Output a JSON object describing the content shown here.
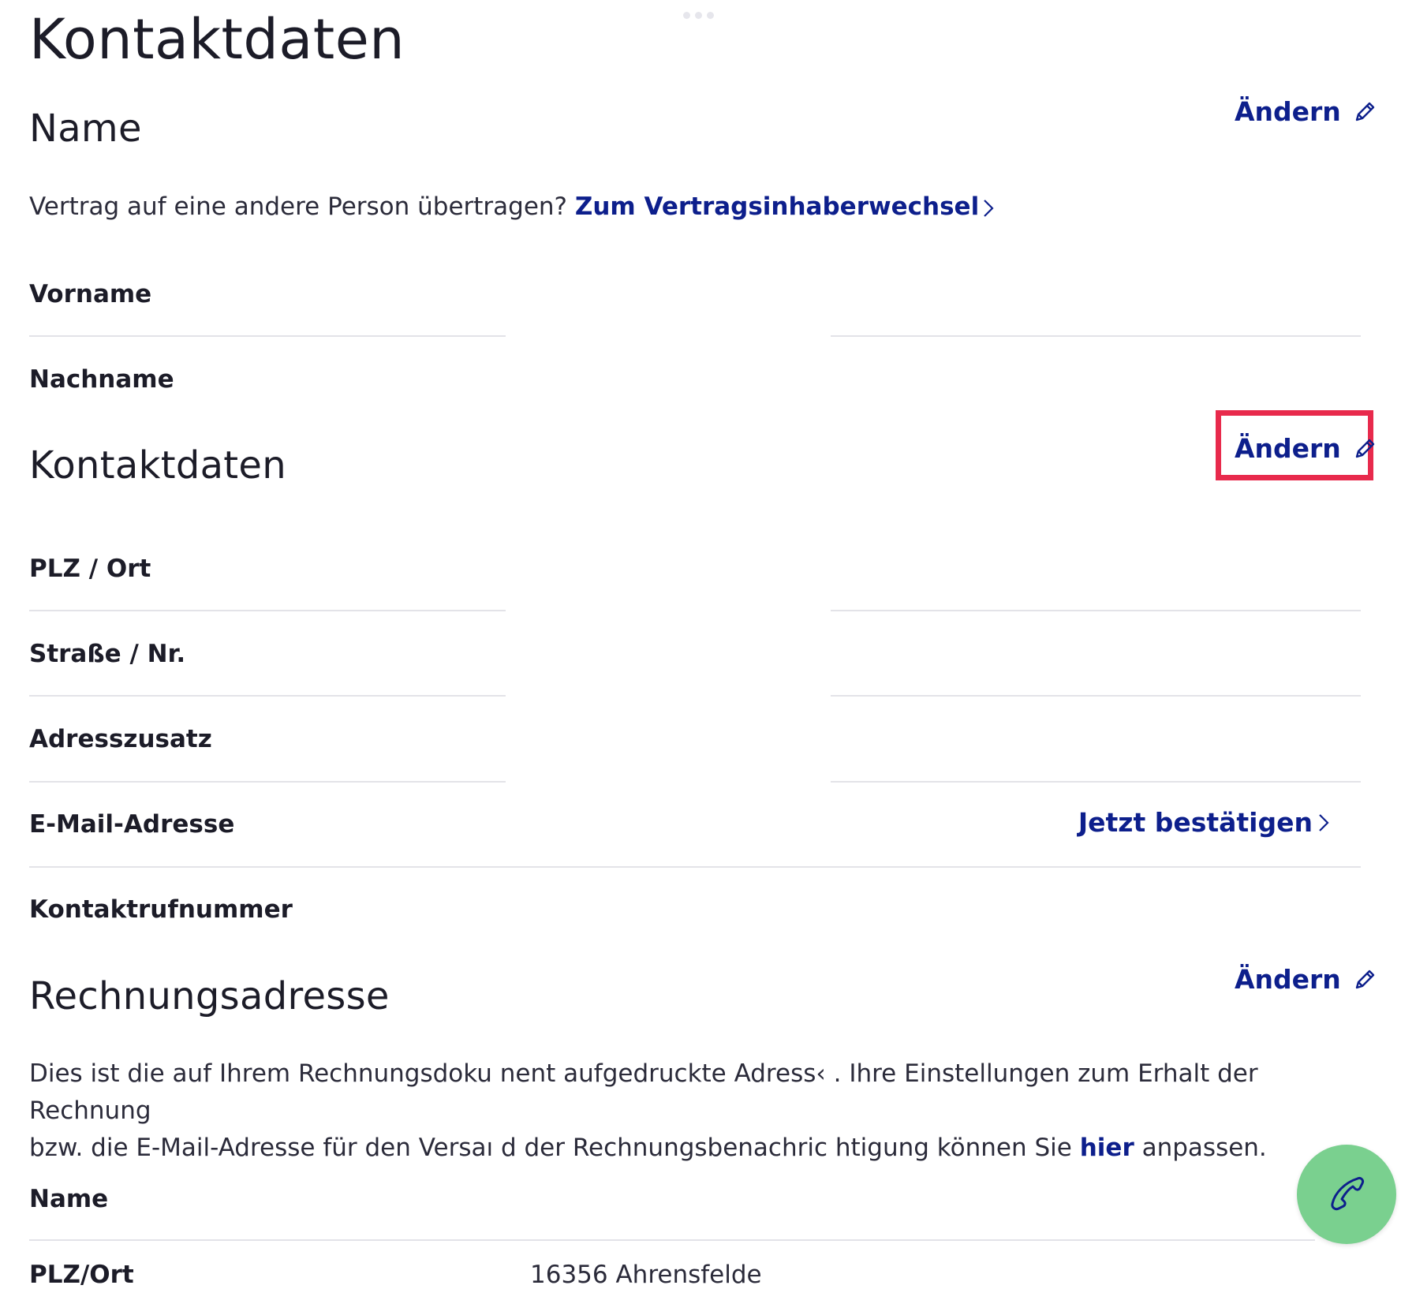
{
  "page": {
    "title": "Kontaktdaten"
  },
  "name_section": {
    "title": "Name",
    "edit_label": "Ändern",
    "transfer_text": "Vertrag auf eine andere Person übertragen?",
    "transfer_link": "Zum Vertragsinhaberwechsel",
    "fields": {
      "first_name_label": "Vorname",
      "last_name_label": "Nachname"
    }
  },
  "contact_section": {
    "title": "Kontaktdaten",
    "edit_label": "Ändern",
    "fields": {
      "zip_city_label": "PLZ / Ort",
      "street_label": "Straße / Nr.",
      "address_extra_label": "Adresszusatz",
      "email_label": "E-Mail-Adresse",
      "email_action": "Jetzt bestätigen",
      "phone_label": "Kontaktrufnummer"
    }
  },
  "billing_section": {
    "title": "Rechnungsadresse",
    "edit_label": "Ändern",
    "info_line1": "Dies ist die auf Ihrem Rechnungsdoku nent aufgedruckte Adress‹ . Ihre Einstellungen zum Erhalt der Rechnung",
    "info_line2_pre": "bzw. die E-Mail-Adresse für den Versaı d der Rechnungsbenachric htigung können Sie",
    "info_link": "hier",
    "info_line2_post": "anpassen.",
    "fields": {
      "name_label": "Name",
      "cut_label": "PLZ/Ort",
      "cut_value": "16356 Ahrensfelde"
    }
  },
  "fab": {
    "icon": "phone-icon"
  },
  "colors": {
    "link": "#0d1f8c",
    "highlight": "#e82a4c",
    "fab": "#7ad08f",
    "divider": "#e3e3e8"
  }
}
